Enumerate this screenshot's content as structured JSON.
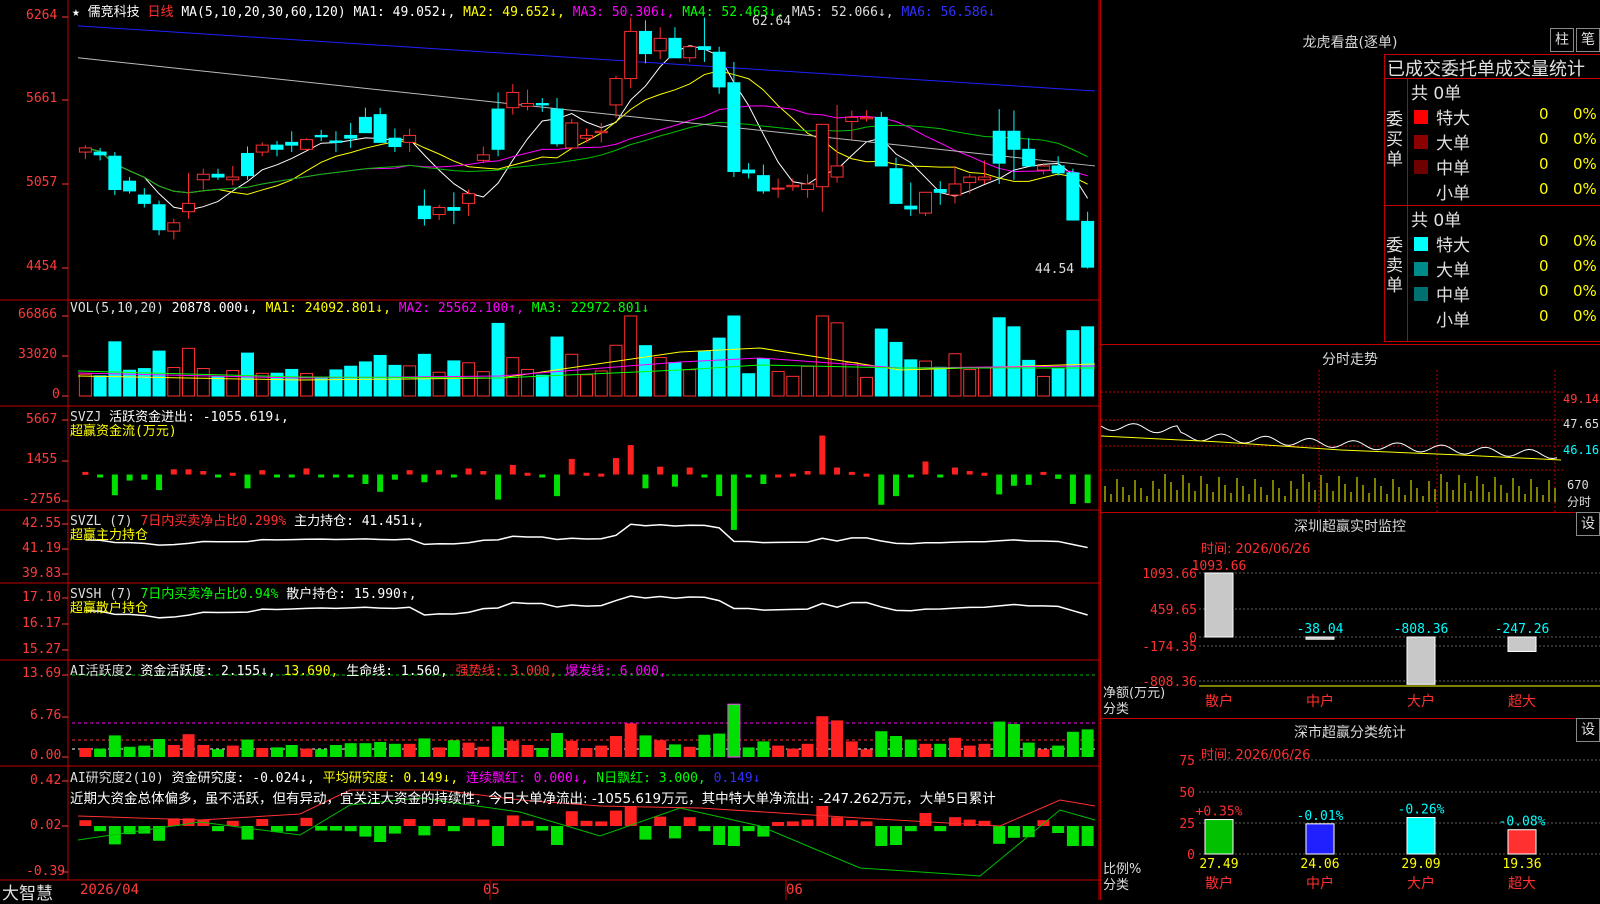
{
  "app": {
    "brand": "大智慧"
  },
  "header": {
    "star": "★",
    "stock": "儒竞科技",
    "period": "日线",
    "ma_params": "MA(5,10,20,30,60,120)",
    "ma1": "MA1: 49.052↓,",
    "ma2": "MA2: 49.652↓,",
    "ma3": "MA3: 50.306↓,",
    "ma4": "MA4: 52.463↓,",
    "ma5": "MA5: 52.066↓,",
    "ma6": "MA6: 56.586↓",
    "high_label": "62.64",
    "low_label": "44.54"
  },
  "price_axis": [
    "6264",
    "5661",
    "5057",
    "4454"
  ],
  "vol_header": {
    "name": "VOL(5,10,20)",
    "v": "20878.000↓,",
    "ma1": "MA1: 24092.801↓,",
    "ma2": "MA2: 25562.100↑,",
    "ma3": "MA3: 22972.801↓"
  },
  "vol_axis": [
    "66866",
    "33020",
    "0"
  ],
  "svzj": {
    "name": "SVZJ",
    "text": "活跃资金进出: -1055.619↓,",
    "sub": "超赢资金流(万元)",
    "axis": [
      "5667",
      "1455",
      "-2756"
    ]
  },
  "svzl": {
    "name": "SVZL (7)",
    "ratio": "7日内买卖净占比0.299%",
    "hold": "主力持仓: 41.451↓,",
    "sub": "超赢主力持仓",
    "axis": [
      "42.55",
      "41.19",
      "39.83"
    ]
  },
  "svsh": {
    "name": "SVSH (7)",
    "ratio": "7日内买卖净占比0.94%",
    "hold": "散户持仓: 15.990↑,",
    "sub": "超赢散户持仓",
    "axis": [
      "17.10",
      "16.17",
      "15.27"
    ]
  },
  "ai2": {
    "name": "AI活跃度2",
    "a": "资金活跃度: 2.155↓,",
    "b": "13.690,",
    "c": "生命线: 1.560,",
    "d": "强势线: 3.000,",
    "e": "爆发线: 6.000,",
    "axis": [
      "13.69",
      "6.76",
      "0.00"
    ]
  },
  "air": {
    "name": "AI研究度2(10)",
    "a": "资金研究度: -0.024↓,",
    "b": "平均研究度: 0.149↓,",
    "c": "连续飘红: 0.000↓,",
    "d": "N日飘红: 3.000,",
    "e": "0.149↓",
    "note": "近期大资金总体偏多，虽不活跃，但有异动，宜关注大资金的持续性，今日大单净流出: -1055.619万元，其中特大单净流出: -247.262万元，大单5日累计",
    "axis": [
      "0.42",
      "0.02",
      "-0.39"
    ]
  },
  "xaxis": [
    "2026/04",
    "05",
    "06"
  ],
  "side": {
    "lhb_title": "龙虎看盘(逐单)",
    "btn_zhu": "柱",
    "btn_bi": "笔",
    "lhb_header": "已成交委托单成交量统计",
    "buy_label": "委买单",
    "sell_label": "委卖单",
    "buy": {
      "total": "共 0单",
      "rows": [
        {
          "name": "特大",
          "count": "0",
          "pct": "0%",
          "color": "#ff0000"
        },
        {
          "name": "大单",
          "count": "0",
          "pct": "0%",
          "color": "#8b0000"
        },
        {
          "name": "中单",
          "count": "0",
          "pct": "0%",
          "color": "#6e0000"
        },
        {
          "name": "小单",
          "count": "0",
          "pct": "0%",
          "color": "#000000"
        }
      ]
    },
    "sell": {
      "total": "共 0单",
      "rows": [
        {
          "name": "特大",
          "count": "0",
          "pct": "0%",
          "color": "#00ffff"
        },
        {
          "name": "大单",
          "count": "0",
          "pct": "0%",
          "color": "#008b8b"
        },
        {
          "name": "中单",
          "count": "0",
          "pct": "0%",
          "color": "#007070"
        },
        {
          "name": "小单",
          "count": "0",
          "pct": "0%",
          "color": "#000000"
        }
      ]
    },
    "fs_title": "分时走势",
    "fs_axis": [
      "49.14",
      "47.65",
      "46.16",
      "670"
    ],
    "fs_label": "分时",
    "sz_title": "深圳超赢实时监控",
    "set": "设",
    "sz_time": "时间: 2026/06/26",
    "sz_axis": [
      "1093.66",
      "459.65",
      "0",
      "-174.35",
      "-808.36"
    ],
    "sz_ylabel": "净额(万元)",
    "sz_xlabel": "分类",
    "sz_bars": [
      {
        "name": "散户",
        "value": 1093.66,
        "label": "1093.66"
      },
      {
        "name": "中户",
        "value": -38.04,
        "label": "-38.04"
      },
      {
        "name": "大户",
        "value": -808.36,
        "label": "-808.36"
      },
      {
        "name": "超大",
        "value": -247.26,
        "label": "-247.26"
      }
    ],
    "ss_title": "深市超赢分类统计",
    "ss_time": "时间: 2026/06/26",
    "ss_axis": [
      "75",
      "50",
      "25",
      "0"
    ],
    "ss_ylabel": "比例%",
    "ss_xlabel": "分类",
    "ss_bars": [
      {
        "name": "散户",
        "value": 27.49,
        "label": "27.49",
        "chg": "+0.35%",
        "color": "#00c000"
      },
      {
        "name": "中户",
        "value": 24.06,
        "label": "24.06",
        "chg": "-0.01%",
        "color": "#2020ff"
      },
      {
        "name": "大户",
        "value": 29.09,
        "label": "29.09",
        "chg": "-0.26%",
        "color": "#00ffff"
      },
      {
        "name": "超大",
        "value": 19.36,
        "label": "19.36",
        "chg": "-0.08%",
        "color": "#ff3030"
      }
    ]
  },
  "chart_data": {
    "type": "candlestick",
    "price_range": [
      44.54,
      62.64
    ],
    "candles": [
      [
        52.9,
        53.4,
        52.4,
        53.2
      ],
      [
        52.9,
        53.2,
        52.3,
        52.7
      ],
      [
        52.6,
        52.9,
        49.8,
        50.2
      ],
      [
        50.8,
        51.1,
        49.9,
        50.1
      ],
      [
        49.8,
        50.3,
        48.9,
        49.2
      ],
      [
        49.1,
        49.4,
        46.9,
        47.3
      ],
      [
        47.2,
        48.1,
        46.6,
        47.8
      ],
      [
        48.6,
        51.4,
        48.1,
        49.2
      ],
      [
        50.9,
        51.7,
        50.2,
        51.3
      ],
      [
        51.3,
        51.7,
        50.9,
        51.1
      ],
      [
        50.9,
        51.9,
        50.5,
        51.1
      ],
      [
        52.8,
        53.3,
        50.9,
        51.2
      ],
      [
        52.9,
        53.6,
        52.6,
        53.4
      ],
      [
        53.4,
        53.7,
        52.6,
        53.1
      ],
      [
        53.6,
        54.4,
        52.9,
        53.4
      ],
      [
        53.1,
        53.9,
        53.0,
        53.8
      ],
      [
        54.1,
        54.5,
        53.7,
        54.0
      ],
      [
        53.7,
        54.4,
        52.9,
        53.6
      ],
      [
        54.1,
        55.0,
        53.2,
        53.9
      ],
      [
        55.4,
        56.1,
        54.3,
        54.3
      ],
      [
        55.6,
        56.1,
        54.1,
        53.6
      ],
      [
        53.9,
        54.6,
        52.9,
        53.3
      ],
      [
        53.6,
        54.6,
        52.9,
        54.1
      ],
      [
        49.0,
        50.2,
        47.6,
        48.1
      ],
      [
        48.4,
        49.1,
        48.0,
        48.9
      ],
      [
        48.9,
        50.0,
        47.7,
        48.7
      ],
      [
        49.2,
        50.2,
        48.3,
        49.9
      ],
      [
        52.3,
        53.3,
        52.1,
        52.7
      ],
      [
        56.0,
        57.2,
        52.6,
        53.1
      ],
      [
        56.1,
        57.8,
        55.6,
        57.2
      ],
      [
        56.2,
        57.4,
        55.9,
        56.4
      ],
      [
        56.4,
        56.8,
        55.8,
        56.3
      ],
      [
        56.0,
        56.8,
        53.3,
        53.5
      ],
      [
        53.2,
        55.3,
        53.1,
        55.0
      ],
      [
        53.9,
        54.6,
        53.6,
        54.1
      ],
      [
        54.3,
        55.0,
        53.6,
        54.4
      ],
      [
        56.3,
        58.4,
        55.4,
        58.2
      ],
      [
        58.2,
        62.6,
        57.5,
        61.6
      ],
      [
        61.6,
        62.4,
        59.3,
        60.0
      ],
      [
        60.2,
        61.9,
        59.6,
        61.1
      ],
      [
        61.1,
        61.9,
        60.3,
        59.7
      ],
      [
        59.7,
        60.6,
        59.4,
        60.5
      ],
      [
        60.5,
        62.6,
        59.4,
        60.3
      ],
      [
        60.1,
        60.5,
        57.1,
        57.6
      ],
      [
        57.9,
        59.4,
        51.1,
        51.5
      ],
      [
        51.6,
        52.1,
        51.0,
        51.4
      ],
      [
        51.2,
        52.0,
        49.9,
        50.1
      ],
      [
        50.3,
        51.0,
        49.6,
        50.3
      ],
      [
        50.4,
        51.0,
        50.1,
        50.5
      ],
      [
        50.2,
        51.3,
        49.6,
        50.6
      ],
      [
        50.4,
        54.9,
        48.6,
        54.9
      ],
      [
        51.1,
        56.3,
        50.7,
        51.9
      ],
      [
        55.1,
        55.9,
        53.8,
        55.4
      ],
      [
        55.3,
        55.9,
        55.1,
        55.4
      ],
      [
        55.4,
        55.8,
        52.0,
        51.9
      ],
      [
        51.7,
        52.5,
        49.5,
        49.2
      ],
      [
        49.0,
        50.7,
        48.3,
        48.8
      ],
      [
        48.5,
        50.0,
        48.3,
        50.0
      ],
      [
        50.2,
        50.8,
        49.1,
        50.0
      ],
      [
        49.8,
        51.9,
        49.2,
        50.6
      ],
      [
        50.7,
        51.3,
        49.9,
        51.1
      ],
      [
        50.9,
        52.3,
        50.6,
        51.1
      ],
      [
        54.4,
        56.0,
        50.6,
        52.1
      ],
      [
        54.4,
        55.9,
        50.9,
        53.1
      ],
      [
        53.1,
        53.9,
        52.0,
        51.9
      ],
      [
        51.6,
        52.1,
        51.3,
        51.9
      ],
      [
        51.9,
        52.6,
        51.2,
        51.4
      ],
      [
        51.4,
        51.7,
        48.0,
        48.0
      ],
      [
        47.9,
        48.6,
        44.5,
        44.6
      ]
    ],
    "volume_range": [
      0,
      66866
    ],
    "svzj_range": [
      -2756,
      5667
    ]
  }
}
